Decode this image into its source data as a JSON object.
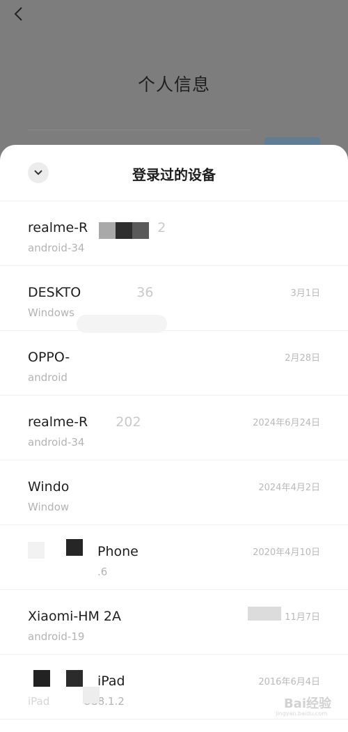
{
  "background_page": {
    "title": "个人信息"
  },
  "sheet": {
    "title": "登录过的设备"
  },
  "devices": [
    {
      "name": "realme-R",
      "name_suffix": "2",
      "os": "android-34",
      "date": ""
    },
    {
      "name": "DESKTO",
      "name_suffix": "36",
      "os": "Windows",
      "date": "3月1日"
    },
    {
      "name": "OPPO-",
      "name_suffix": "",
      "os": "android",
      "date": "2月28日"
    },
    {
      "name": "realme-R",
      "name_suffix": "202",
      "os": "android-34",
      "date": "2024年6月24日"
    },
    {
      "name": "Windo",
      "name_suffix": "",
      "os": "Window",
      "date": "2024年4月2日"
    },
    {
      "name": "",
      "name_suffix": "Phone",
      "os": "",
      "os_suffix": ".6",
      "date": "2020年4月10日"
    },
    {
      "name": "Xiaomi-HM 2A",
      "name_suffix": "",
      "os": "android-19",
      "date": "11月7日"
    },
    {
      "name": "",
      "name_suffix": "iPad",
      "os": "iPad",
      "os_suffix": "OS8.1.2",
      "date": "2016年6月4日"
    }
  ],
  "watermark": {
    "text": "Bai经验",
    "sub": "jingyan.baidu.com"
  },
  "icons": {
    "back": "back-chevron-icon",
    "collapse": "chevron-down-icon"
  },
  "colors": {
    "overlay": "#7d7d7d",
    "sheet_bg": "#ffffff",
    "text_primary": "#1e1e1e",
    "text_secondary": "#b3b3b3"
  }
}
